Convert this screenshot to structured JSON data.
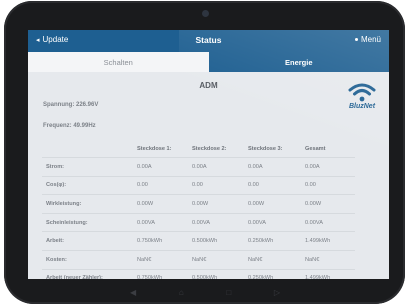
{
  "header": {
    "update_label": "Update",
    "title": "Status",
    "menu_label": "Menü"
  },
  "tabs": [
    {
      "label": "Schalten",
      "active": false
    },
    {
      "label": "Energie",
      "active": true
    }
  ],
  "device_name": "ADM",
  "info": {
    "spannung": "Spannung: 226.96V",
    "frequenz": "Frequenz: 49.99Hz"
  },
  "brand": {
    "name": "BluzNet",
    "icon": "wifi-icon",
    "color": "#1e5f91"
  },
  "table": {
    "headers": [
      "",
      "Steckdose 1:",
      "Steckdose 2:",
      "Steckdose 3:",
      "Gesamt"
    ],
    "rows": [
      {
        "label": "Strom:",
        "values": [
          "0.00A",
          "0.00A",
          "0.00A",
          "0.00A"
        ]
      },
      {
        "label": "Cos(φ):",
        "values": [
          "0.00",
          "0.00",
          "0.00",
          "0.00"
        ]
      },
      {
        "label": "Wirkleistung:",
        "values": [
          "0.00W",
          "0.00W",
          "0.00W",
          "0.00W"
        ]
      },
      {
        "label": "Scheinleistung:",
        "values": [
          "0.00VA",
          "0.00VA",
          "0.00VA",
          "0.00VA"
        ]
      },
      {
        "label": "Arbeit:",
        "values": [
          "0.750kWh",
          "0.500kWh",
          "0.250kWh",
          "1.499kWh"
        ]
      },
      {
        "label": "Kosten:",
        "values": [
          "NaN€",
          "NaN€",
          "NaN€",
          "NaN€"
        ]
      },
      {
        "label": "Arbeit (neuer Zähler):",
        "values": [
          "0.750kWh",
          "0.500kWh",
          "0.250kWh",
          "1.499kWh"
        ]
      }
    ]
  },
  "colors": {
    "accent": "#1e5f91",
    "screen_bg": "#e6e9ed",
    "device_frame": "#1a1b1d"
  }
}
